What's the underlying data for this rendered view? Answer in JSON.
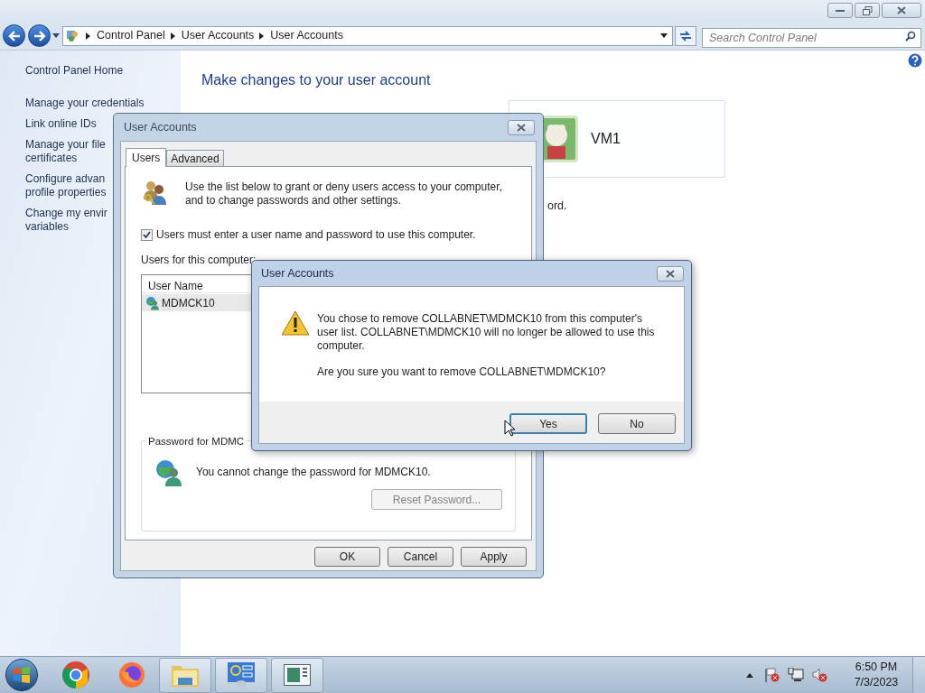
{
  "window": {
    "breadcrumb": [
      "Control Panel",
      "User Accounts",
      "User Accounts"
    ],
    "search": {
      "placeholder": "Search Control Panel"
    }
  },
  "sidebar": {
    "items": [
      {
        "lines": [
          "Control Panel Home"
        ]
      },
      {
        "lines": [
          "Manage your credentials"
        ]
      },
      {
        "lines": [
          "Link online IDs"
        ]
      },
      {
        "lines": [
          "Manage your file",
          "certificates"
        ]
      },
      {
        "lines": [
          "Configure advan",
          "profile properties"
        ]
      },
      {
        "lines": [
          "Change my envir",
          "variables"
        ]
      }
    ]
  },
  "main": {
    "heading": "Make changes to your user account",
    "fragment": "ord.",
    "account": {
      "name": "VM1"
    }
  },
  "dialog": {
    "title": "User Accounts",
    "tabs": [
      {
        "label": "Users",
        "selected": true
      },
      {
        "label": "Advanced",
        "selected": false
      }
    ],
    "description": "Use the list below to grant or deny users access to your computer, and to change passwords and other settings.",
    "checkbox": {
      "label": "Users must enter a user name and password to use this computer.",
      "checked": true
    },
    "list_label": "Users for this computer:",
    "list": {
      "columns": [
        "User Name"
      ],
      "rows": [
        {
          "name": "MDMCK10",
          "selected": true
        }
      ]
    },
    "password_group": {
      "label": "Password for MDMC",
      "text": "You cannot change the password for MDMCK10.",
      "button": {
        "label": "Reset Password...",
        "disabled": true
      }
    },
    "buttons": [
      "OK",
      "Cancel",
      "Apply"
    ]
  },
  "confirm": {
    "title": "User Accounts",
    "message": "You chose to remove COLLABNET\\MDMCK10 from this computer's user list. COLLABNET\\MDMCK10 will no longer be allowed to use this computer.",
    "question": "Are you sure you want to remove COLLABNET\\MDMCK10?",
    "buttons": [
      {
        "label": "Yes",
        "default": true
      },
      {
        "label": "No",
        "default": false
      }
    ]
  },
  "taskbar": {
    "time": "6:50 PM",
    "date": "7/3/2023"
  }
}
